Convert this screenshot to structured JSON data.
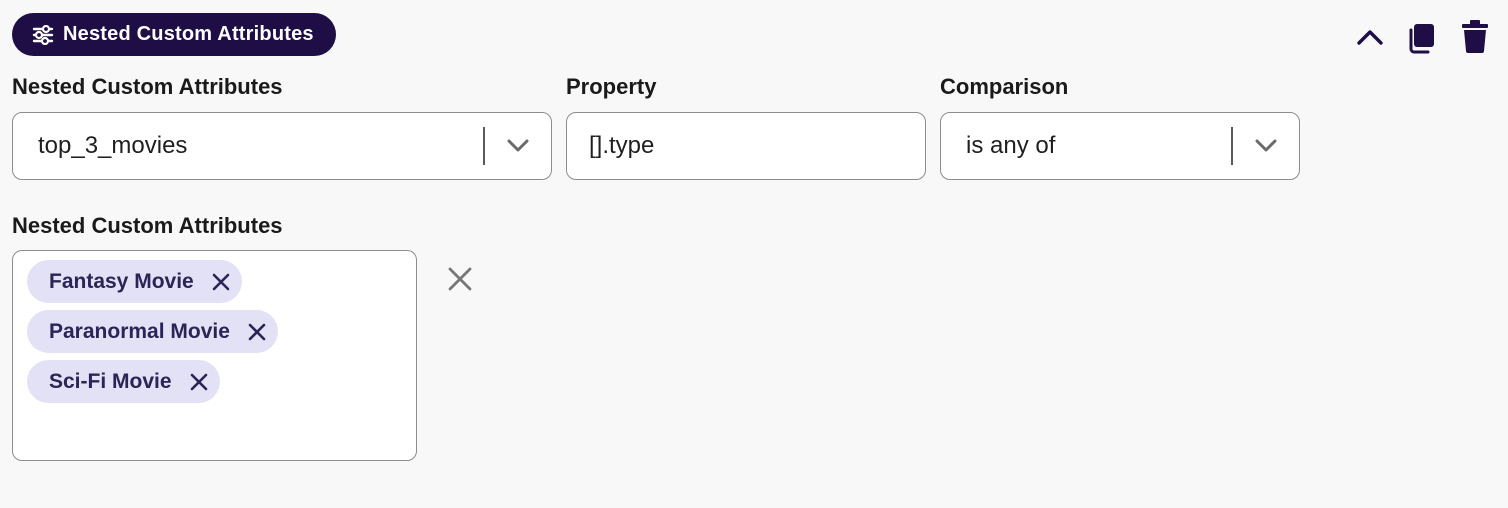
{
  "header": {
    "badge_label": "Nested Custom Attributes",
    "badge_icon": "sliders-icon",
    "actions": [
      {
        "icon": "chevron-up-icon"
      },
      {
        "icon": "copy-icon"
      },
      {
        "icon": "trash-icon"
      }
    ]
  },
  "fields": {
    "nested_attr": {
      "label": "Nested Custom Attributes",
      "value": "top_3_movies"
    },
    "property": {
      "label": "Property",
      "value": "[].type"
    },
    "comparison": {
      "label": "Comparison",
      "value": "is any of"
    }
  },
  "values": {
    "label": "Nested Custom Attributes",
    "chips": [
      "Fantasy Movie",
      "Paranormal Movie",
      "Sci-Fi Movie"
    ]
  },
  "colors": {
    "badge_bg": "#1e0e45",
    "chip_bg": "#e3e1f6",
    "chip_text": "#2a2457",
    "icon": "#1e0e45"
  }
}
